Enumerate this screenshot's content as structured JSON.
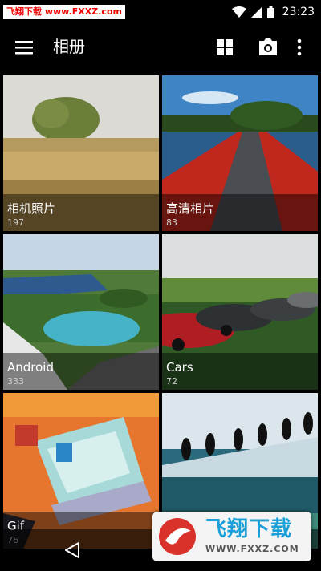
{
  "status_bar": {
    "watermark_text": "飞翔下载 www.FXXZ.com",
    "time": "23:23"
  },
  "app_bar": {
    "title": "相册",
    "icons": [
      "menu-icon",
      "grid-icon",
      "camera-icon",
      "more-vert-icon"
    ]
  },
  "albums": [
    {
      "name": "相机照片",
      "count": "197"
    },
    {
      "name": "高清相片",
      "count": "83"
    },
    {
      "name": "Android",
      "count": "333"
    },
    {
      "name": "Cars",
      "count": "72"
    },
    {
      "name": "Gif",
      "count": "76"
    },
    {
      "name": "",
      "count": ""
    }
  ],
  "watermark": {
    "title": "飞翔下载",
    "url": "WWW.FXXZ.COM"
  },
  "colors": {
    "background": "#000000",
    "watermark_blue": "#1a9fd8",
    "watermark_red": "#e00000"
  }
}
